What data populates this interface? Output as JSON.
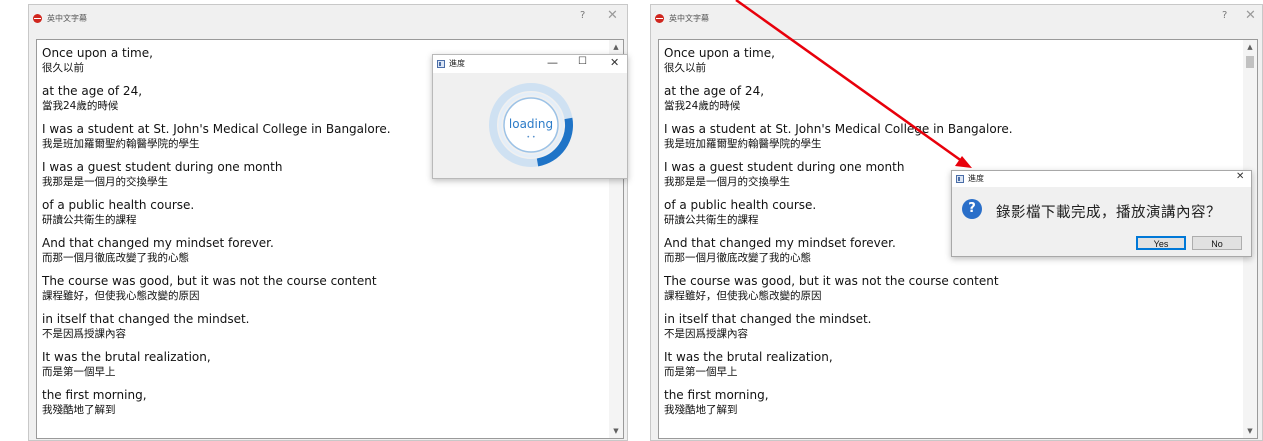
{
  "left_window": {
    "title": "英中文字幕",
    "help": "?",
    "close": "✕",
    "entries": [
      {
        "en": "Once upon a time,",
        "zh": "很久以前"
      },
      {
        "en": "at the age of 24,",
        "zh": "當我24歲的時候"
      },
      {
        "en": "I was a student at St. John's Medical College in Bangalore.",
        "zh": "我是班加羅爾聖約翰醫學院的學生"
      },
      {
        "en": "I was a guest student during one month",
        "zh": "我那是是一個月的交換學生"
      },
      {
        "en": "of a public health course.",
        "zh": "研讀公共衛生的課程"
      },
      {
        "en": "And that changed my mindset forever.",
        "zh": "而那一個月徹底改變了我的心態"
      },
      {
        "en": "The course was good, but it was not the course content",
        "zh": "課程雖好，但使我心態改變的原因"
      },
      {
        "en": "in itself that changed the mindset.",
        "zh": "不是因爲授課內容"
      },
      {
        "en": "It was the brutal realization,",
        "zh": "而是第一個早上"
      },
      {
        "en": "the first morning,",
        "zh": "我殘酷地了解到"
      }
    ]
  },
  "right_window": {
    "title": "英中文字幕",
    "help": "?",
    "close": "✕",
    "entries": [
      {
        "en": "Once upon a time,",
        "zh": "很久以前"
      },
      {
        "en": "at the age of 24,",
        "zh": "當我24歲的時候"
      },
      {
        "en": "I was a student at St. John's Medical College in Bangalore.",
        "zh": "我是班加羅爾聖約翰醫學院的學生"
      },
      {
        "en": "I was a guest student during one month",
        "zh": "我那是是一個月的交換學生"
      },
      {
        "en": "of a public health course.",
        "zh": "研讀公共衛生的課程"
      },
      {
        "en": "And that changed my mindset forever.",
        "zh": "而那一個月徹底改變了我的心態"
      },
      {
        "en": "The course was good, but it was not the course content",
        "zh": "課程雖好，但使我心態改變的原因"
      },
      {
        "en": "in itself that changed the mindset.",
        "zh": "不是因爲授課內容"
      },
      {
        "en": "It was the brutal realization,",
        "zh": "而是第一個早上"
      },
      {
        "en": "the first morning,",
        "zh": "我殘酷地了解到"
      }
    ]
  },
  "progress_dialog": {
    "title": "進度",
    "minimize": "—",
    "maximize": "☐",
    "close": "✕",
    "status": "loading",
    "dots": "• •",
    "progress_fraction": 0.25
  },
  "question_dialog": {
    "title": "進度",
    "close": "✕",
    "icon": "?",
    "message": "錄影檔下載完成，播放演講內容？",
    "yes": "Yes",
    "no": "No"
  },
  "colors": {
    "arrow": "#e8000b",
    "ring_progress": "#1f74c7",
    "ring_track": "#b7d3ec"
  },
  "icons": [
    "app-icon",
    "dialog-icon",
    "question-icon",
    "scroll-up-icon",
    "scroll-down-icon"
  ]
}
